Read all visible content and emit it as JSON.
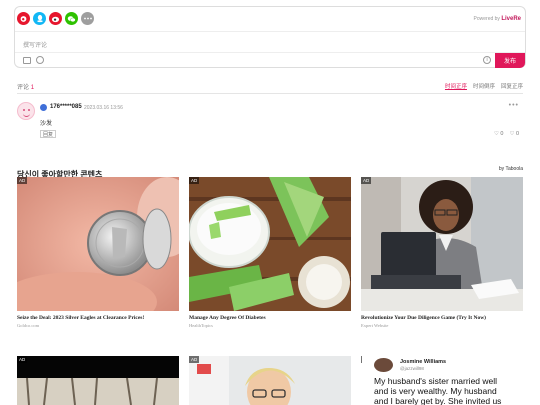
{
  "top_bar": {
    "powered_prefix": "Powered by",
    "powered_brand": "LiveRe",
    "social_icons": [
      {
        "name": "weibo-icon",
        "color": "#e6162d"
      },
      {
        "name": "qq-icon",
        "color": "#12b7f5"
      },
      {
        "name": "weibo-alt-icon",
        "color": "#e6162d"
      },
      {
        "name": "wechat-icon",
        "color": "#2ec100"
      },
      {
        "name": "more-icon",
        "color": "#9e9e9e"
      }
    ]
  },
  "comment_box": {
    "placeholder": "撰写评论",
    "publish_label": "发布"
  },
  "comments_header": {
    "label": "评论",
    "count": "1",
    "sort_options": [
      "时间正序",
      "时间倒序",
      "回复正序"
    ],
    "active_sort": "时间正序"
  },
  "comment": {
    "user": "176*****085",
    "date": "2023.03.16 13:56",
    "text": "沙发",
    "reply_label": "回复",
    "likes": "0",
    "dislikes": "0",
    "more": "•••"
  },
  "recommendations": {
    "title": "당신이 좋아할만한 콘텐츠",
    "by_label": "by Taboola",
    "ad_label": "AD",
    "cards": [
      {
        "title": "Seize the Deal: 2023 Silver Eagles at Clearance Prices!",
        "source": "Goldco.com"
      },
      {
        "title": "Manage Any Degree Of Diabetes",
        "source": "HealthTopics"
      },
      {
        "title": "Revolutionize Your Due Diligence Game (Try It Now)",
        "source": "Expert Website"
      }
    ]
  },
  "tweet": {
    "name": "Josmine Williams",
    "handle": "@jazzwill98",
    "text_lines": [
      "My husband's sister married well",
      "and is very wealthy. My husband",
      "and I barely get by. She invited us"
    ]
  }
}
